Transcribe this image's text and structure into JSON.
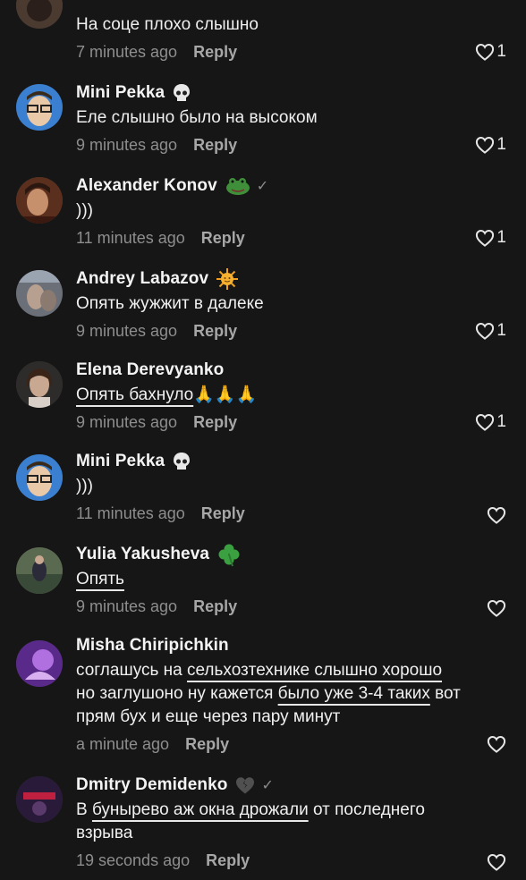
{
  "comments": [
    {
      "name": "",
      "text": "На соце плохо слышно",
      "time": "7 minutes ago",
      "reply": "Reply",
      "likes": "1"
    },
    {
      "name": "Mini Pekka",
      "badge": "skull-emoji",
      "text": "Еле слышно было на высоком",
      "time": "9 minutes ago",
      "reply": "Reply",
      "likes": "1"
    },
    {
      "name": "Alexander Konov",
      "badge": "frog-emoji",
      "verified": "✓",
      "text": ")))",
      "time": "11 minutes ago",
      "reply": "Reply",
      "likes": "1"
    },
    {
      "name": "Andrey Labazov",
      "badge": "sun-emoji",
      "text": "Опять жужжит в далеке",
      "time": "9 minutes ago",
      "reply": "Reply",
      "likes": "1"
    },
    {
      "name": "Elena Derevyanko",
      "text": "Опять бахнуло",
      "text_emoji": "🙏🙏🙏",
      "time": "9 minutes ago",
      "reply": "Reply",
      "likes": "1"
    },
    {
      "name": "Mini Pekka",
      "badge": "skull-emoji",
      "text": ")))",
      "time": "11 minutes ago",
      "reply": "Reply",
      "likes": ""
    },
    {
      "name": "Yulia Yakusheva",
      "badge": "clover-emoji",
      "text": "Опять",
      "time": "9 minutes ago",
      "reply": "Reply",
      "likes": ""
    },
    {
      "name": "Misha Chiripichkin",
      "text_parts": [
        "соглашусь на ",
        "сельхозтехнике слышно хорошо",
        " ",
        "но заглушоно ну кажется ",
        "было уже 3-4 таких",
        " ",
        "вот прям бух и еще через пару минут"
      ],
      "time": "a minute ago",
      "reply": "Reply",
      "likes": ""
    },
    {
      "name": "Dmitry Demidenko",
      "badge": "broken-heart-emoji",
      "verified": "✓",
      "text_parts": [
        "В ",
        "бунырево аж окна дрожали",
        " от последнего взрыва"
      ],
      "time": "19 seconds ago",
      "reply": "Reply",
      "likes": ""
    }
  ],
  "colors": {
    "background": "#161616",
    "time": "#8e8e8e",
    "reply": "#a7a7a7"
  }
}
